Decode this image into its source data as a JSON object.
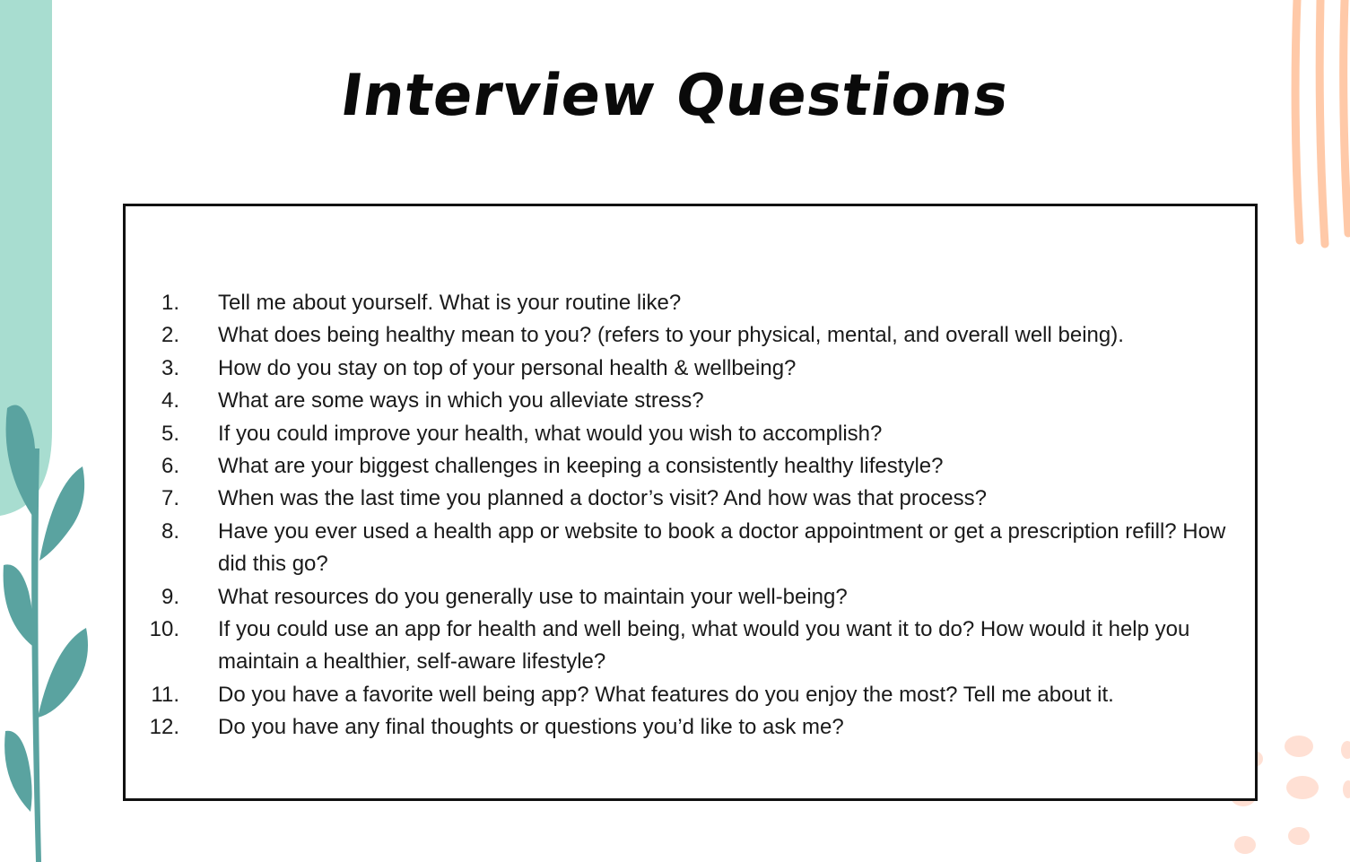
{
  "title": "Interview Questions",
  "colors": {
    "mint_panel": "#a8ddd0",
    "leaf_teal": "#5aa3a0",
    "peach_strokes": "#ffc9a8",
    "peach_dots": "#ffe0d4"
  },
  "questions": [
    {
      "number": "1.",
      "text": "Tell me about yourself. What is your routine like?"
    },
    {
      "number": "2.",
      "text": "What does being healthy mean to you? (refers to your physical, mental, and overall well being)."
    },
    {
      "number": "3.",
      "text": "How do you stay on top of your personal health & wellbeing?"
    },
    {
      "number": "4.",
      "text": "What are some ways in which you alleviate stress?"
    },
    {
      "number": "5.",
      "text": "If you could improve your health, what would you wish to accomplish?"
    },
    {
      "number": "6.",
      "text": "What are your biggest challenges in keeping a consistently healthy lifestyle?"
    },
    {
      "number": "7.",
      "text": "When was the last time you planned a doctor’s visit? And how was that process?"
    },
    {
      "number": "8.",
      "text": "Have you ever used a health app or website to book a doctor appointment or get a prescription refill? How did this go?"
    },
    {
      "number": "9.",
      "text": "What resources do you generally use to maintain your well-being?"
    },
    {
      "number": "10.",
      "text": "If you could use an app for health and well being, what would you want it to do? How would it help you maintain a healthier, self-aware lifestyle?"
    },
    {
      "number": "11.",
      "text": "Do you have a favorite well being app? What features do you enjoy the most? Tell me about it."
    },
    {
      "number": "12.",
      "text": "Do you have any final thoughts or questions you’d like to ask me?"
    }
  ]
}
